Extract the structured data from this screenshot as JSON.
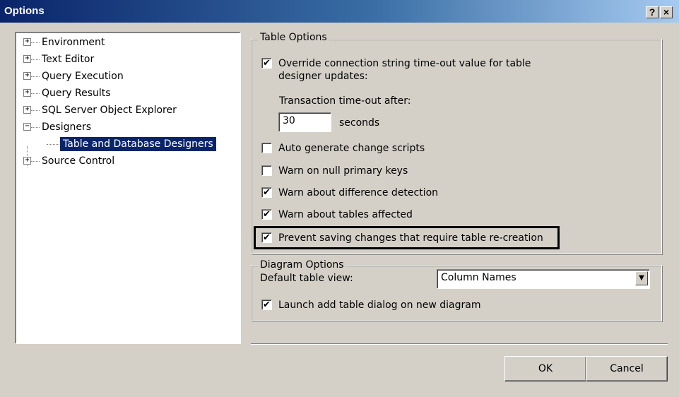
{
  "window": {
    "title": "Options",
    "help_label": "?",
    "close_label": "×"
  },
  "tree": {
    "items": [
      {
        "label": "Environment",
        "expander": "+"
      },
      {
        "label": "Text Editor",
        "expander": "+"
      },
      {
        "label": "Query Execution",
        "expander": "+"
      },
      {
        "label": "Query Results",
        "expander": "+"
      },
      {
        "label": "SQL Server Object Explorer",
        "expander": "+"
      },
      {
        "label": "Designers",
        "expander": "−"
      },
      {
        "label": "Table and Database Designers",
        "selected": true
      },
      {
        "label": "Source Control",
        "expander": "+"
      }
    ]
  },
  "table_options": {
    "title": "Table Options",
    "override": {
      "label_line1": "Override connection string time-out value for table",
      "label_line2": "designer updates:",
      "checked": true
    },
    "timeout_label": "Transaction time-out after:",
    "timeout_value": "30",
    "timeout_unit": "seconds",
    "auto_generate": {
      "label": "Auto generate change scripts",
      "checked": false
    },
    "warn_null_pk": {
      "label": "Warn on null primary keys",
      "checked": false
    },
    "warn_diff": {
      "label": "Warn about difference detection",
      "checked": true
    },
    "warn_tables": {
      "label": "Warn about tables affected",
      "checked": true
    },
    "prevent_saving": {
      "label": "Prevent saving changes that require table re-creation",
      "checked": true
    }
  },
  "diagram_options": {
    "title": "Diagram Options",
    "default_view_label": "Default table view:",
    "default_view_value": "Column Names",
    "launch_add_table": {
      "label": "Launch add table dialog on new diagram",
      "checked": true
    }
  },
  "check_mark": "✔",
  "dropdown_arrow": "▼",
  "buttons": {
    "ok": "OK",
    "cancel": "Cancel"
  }
}
